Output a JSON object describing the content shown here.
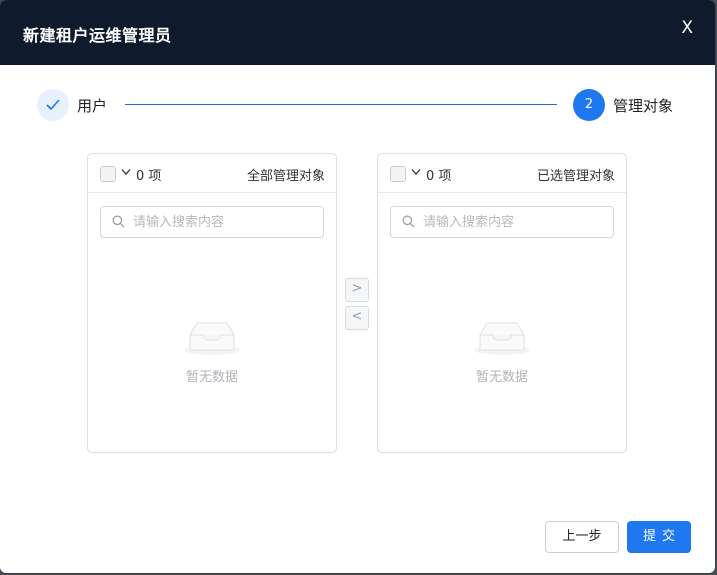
{
  "dialog": {
    "title": "新建租户运维管理员",
    "close_label": "X"
  },
  "steps": [
    {
      "label": "用户",
      "state": "done",
      "icon": "check-icon"
    },
    {
      "number": "2",
      "label": "管理对象",
      "state": "active"
    }
  ],
  "transfer": {
    "left": {
      "count_label": "0 项",
      "title": "全部管理对象",
      "search_placeholder": "请输入搜索内容",
      "empty_text": "暂无数据"
    },
    "right": {
      "count_label": "0 项",
      "title": "已选管理对象",
      "search_placeholder": "请输入搜索内容",
      "empty_text": "暂无数据"
    },
    "move_right_label": ">",
    "move_left_label": "<"
  },
  "footer": {
    "prev_label": "上一步",
    "submit_label": "提交"
  },
  "colors": {
    "header_bg": "#0f1b2d",
    "primary": "#1f78f0",
    "step_done_bg": "#e7f1fd"
  }
}
